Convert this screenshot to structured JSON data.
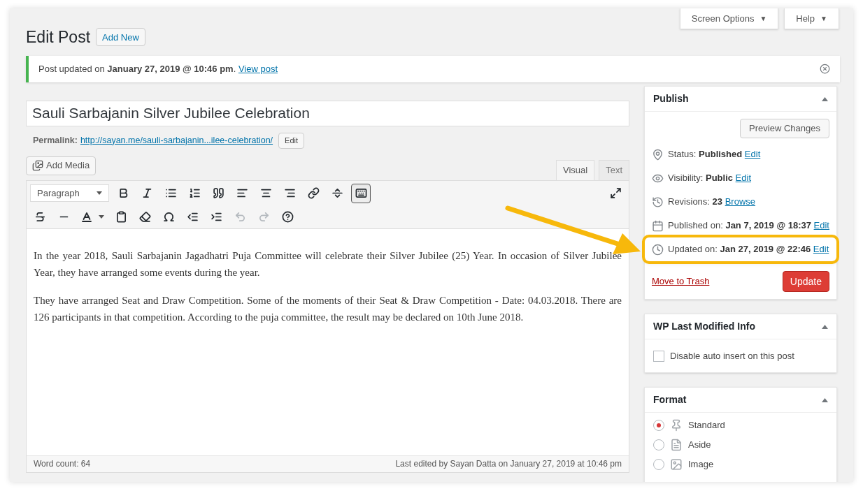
{
  "screen_tabs": [
    {
      "label": "Screen Options",
      "caret": "▼"
    },
    {
      "label": "Help",
      "caret": "▼"
    }
  ],
  "heading": {
    "title": "Edit Post",
    "button": "Add New"
  },
  "notice": {
    "text": "Post updated on **January 27, 2019 @ 10:46 pm**.",
    "link": "View post"
  },
  "post": {
    "title": "Sauli Sarbajanin Silver Jubilee Celebration",
    "permalink_label": "Permalink:",
    "permalink": "http://sayan.me/sauli-sarbajanin...ilee-celebration/",
    "permalink_button": "Edit"
  },
  "editor": {
    "add_media": "Add Media",
    "tabs": [
      {
        "label": "Visual",
        "selected": true
      },
      {
        "label": "Text",
        "selected": false
      }
    ],
    "format_select": "Paragraph",
    "toolbar": {
      "toggle_pressed": true,
      "undo_disabled": true,
      "redo_disabled": true
    },
    "paragraphs": [
      "In the year 2018, Sauli Sarbajanin Jagadhatri Puja Committee will celebrate their Silver Jubilee (25) Year. In occasion of Silver Jubilee Year, they have arranged some events during the year.",
      "They have arranged Seat and Draw Competition. Some of the moments of their Seat & Draw Competition - Date: 04.03.2018. There are 126 participants in that competition. According to the puja committee, the result may be declared on 10th June 2018."
    ],
    "word_count": "Word count: 64",
    "last_edited": "Last edited by Sayan Datta on January 27, 2019 at 10:46 pm"
  },
  "publish": {
    "title": "Publish",
    "preview_button": "Preview Changes",
    "rows": [
      {
        "kind": "pin",
        "label": "Status:",
        "value": "Published",
        "link": "Edit",
        "highlighted": false
      },
      {
        "kind": "eye",
        "label": "Visibility:",
        "value": "Public",
        "link": "Edit",
        "highlighted": false
      },
      {
        "kind": "history",
        "label": "Revisions:",
        "value": "23",
        "link": "Browse",
        "highlighted": false
      },
      {
        "kind": "calendar",
        "label": "Published on:",
        "value": "Jan 7, 2019 @ 18:37",
        "link": "Edit",
        "highlighted": false
      },
      {
        "kind": "clock",
        "label": "Updated on:",
        "value": "Jan 27, 2019 @ 22:46",
        "link": "Edit",
        "highlighted": true
      }
    ],
    "trash": "Move to Trash",
    "update_button": "Update"
  },
  "last_modified": {
    "title": "WP Last Modified Info",
    "checkbox": {
      "label": "Disable auto insert on this post",
      "checked": false
    }
  },
  "format": {
    "title": "Format",
    "options": [
      {
        "kind": "standard",
        "label": "Standard",
        "selected": true
      },
      {
        "kind": "aside",
        "label": "Aside",
        "selected": false
      },
      {
        "kind": "image",
        "label": "Image",
        "selected": false
      }
    ]
  }
}
